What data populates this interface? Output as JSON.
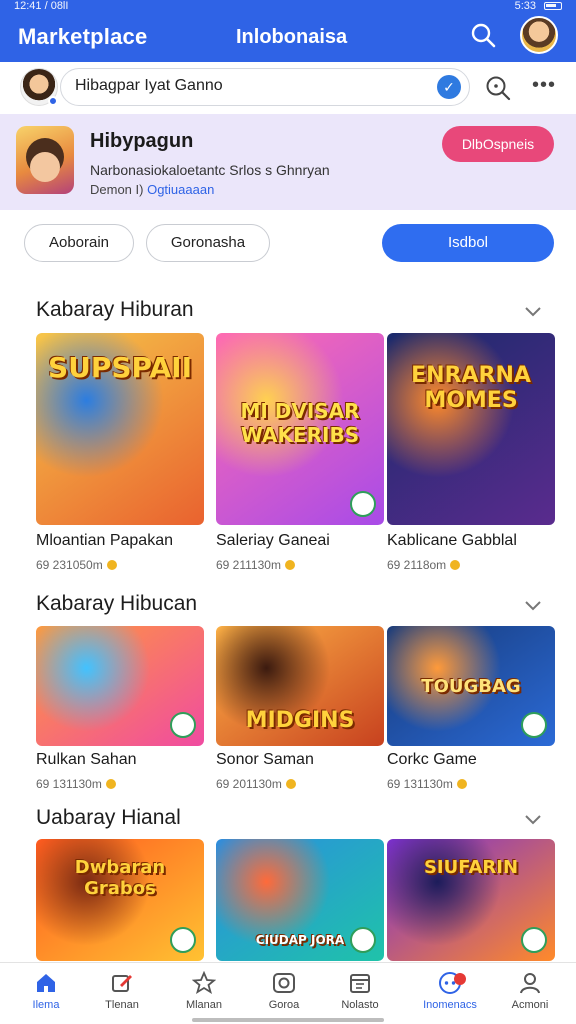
{
  "status_bar": {
    "time": "12:41 / 08lI",
    "right_text": "5:33"
  },
  "header": {
    "title": "Marketplace",
    "center_title": "Inlobonaisa"
  },
  "search": {
    "value": "Hibagpar Iyat Ganno",
    "verify_symbol": "✓"
  },
  "promo": {
    "title": "Hibypagun",
    "description": "Narbonasiokaloetantc Srlos s Ghnryan",
    "sub_prefix": "Demon I)",
    "sub_link": "Ogtiuaaaan",
    "button": "DlbOspneis"
  },
  "filters": {
    "chip_1": "Aoborain",
    "chip_2": "Goronasha",
    "primary": "Isdbol"
  },
  "sections": [
    {
      "title": "Kabaray Hiburan",
      "cards": [
        {
          "title": "Mloantian Papakan",
          "meta": "69 231050m",
          "art_text": "SUPSPAII",
          "colors": [
            "#f6c64a",
            "#e9622f",
            "#2c7de0"
          ]
        },
        {
          "title": "Saleriay Ganeai",
          "meta": "69 211130m",
          "art_text": "MI DVISAR WAKERIBS",
          "colors": [
            "#ff6cb0",
            "#a84be8",
            "#ffd150"
          ]
        },
        {
          "title": "Kablicane Gabblal",
          "meta": "69 2118om",
          "art_text": "ENRARNA MOMES",
          "colors": [
            "#1b2a6b",
            "#5a2b8e",
            "#ff8a2a"
          ]
        }
      ]
    },
    {
      "title": "Kabaray Hibucan",
      "cards": [
        {
          "title": "Rulkan Sahan",
          "meta": "69 131130m",
          "art_text": "",
          "colors": [
            "#ff9a3c",
            "#f04ba1",
            "#42c2ff"
          ]
        },
        {
          "title": "Sonor Saman",
          "meta": "69 201130m",
          "art_text": "MIDGINS",
          "colors": [
            "#ffb347",
            "#c7411f",
            "#3b1a0f"
          ]
        },
        {
          "title": "Corkc Game",
          "meta": "69 131130m",
          "art_text": "TOUGBAG",
          "colors": [
            "#173a7a",
            "#2b6ad6",
            "#ff9a3a"
          ]
        }
      ]
    },
    {
      "title": "Uabaray Hianal",
      "cards": [
        {
          "title": "",
          "meta": "",
          "art_text": "Dwbaran Grabos",
          "colors": [
            "#ff5a1f",
            "#ffc232",
            "#7a2a12"
          ]
        },
        {
          "title": "",
          "meta": "",
          "art_text": "CIUDAP JORA",
          "colors": [
            "#2b8de0",
            "#1fc3a9",
            "#ff6a3a"
          ]
        },
        {
          "title": "",
          "meta": "",
          "art_text": "SIUFARIN",
          "colors": [
            "#7a2fcf",
            "#ff8a2a",
            "#1c1c5a"
          ]
        }
      ]
    }
  ],
  "bottom_nav": [
    {
      "label": "Ilema",
      "icon": "home-icon",
      "active": true
    },
    {
      "label": "Tlenan",
      "icon": "edit-icon",
      "active": false
    },
    {
      "label": "Mlanan",
      "icon": "star-icon",
      "active": false
    },
    {
      "label": "Goroa",
      "icon": "camera-icon",
      "active": false
    },
    {
      "label": "Nolasto",
      "icon": "calendar-icon",
      "active": false
    },
    {
      "label": "Inomenacs",
      "icon": "game-icon",
      "active": true
    },
    {
      "label": "Acmoni",
      "icon": "profile-icon",
      "active": false
    }
  ],
  "colors": {
    "brand": "#2f63e6",
    "promo_button": "#e8487a",
    "primary_button": "#2f6df0"
  }
}
